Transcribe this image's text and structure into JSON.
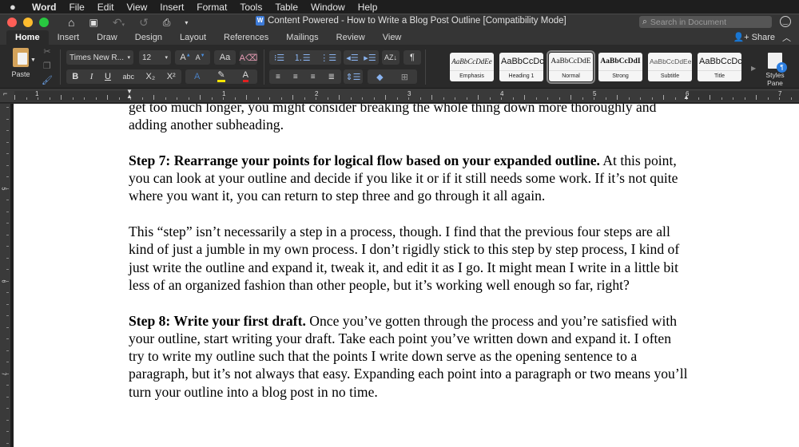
{
  "menubar": {
    "apple_icon": "apple-logo-icon",
    "items": [
      "Word",
      "File",
      "Edit",
      "View",
      "Insert",
      "Format",
      "Tools",
      "Table",
      "Window",
      "Help"
    ]
  },
  "window": {
    "title": "Content Powered - How to Write a Blog Post Outline [Compatibility Mode]",
    "traffic_lights": {
      "close": "#ff5f57",
      "minimize": "#febc2e",
      "zoom": "#28c840"
    },
    "quick_access": [
      "home-icon",
      "save-icon",
      "undo-icon",
      "redo-icon",
      "print-icon",
      "customize-icon"
    ],
    "search_placeholder": "Search in Document"
  },
  "tabs": {
    "items": [
      "Home",
      "Insert",
      "Draw",
      "Design",
      "Layout",
      "References",
      "Mailings",
      "Review",
      "View"
    ],
    "active": "Home",
    "share_label": "Share"
  },
  "ribbon": {
    "paste_label": "Paste",
    "font_name": "Times New R...",
    "font_size": "12",
    "format_buttons": [
      "B",
      "I",
      "U",
      "abc",
      "X₂",
      "X²"
    ],
    "styles": [
      {
        "preview": "AaBbCcDdEe",
        "label": "Emphasis"
      },
      {
        "preview": "AaBbCcDc",
        "label": "Heading 1"
      },
      {
        "preview": "AaBbCcDdE",
        "label": "Normal",
        "selected": true
      },
      {
        "preview": "AaBbCcDdI",
        "label": "Strong"
      },
      {
        "preview": "AaBbCcDdEe",
        "label": "Subtitle"
      },
      {
        "preview": "AaBbCcDc",
        "label": "Title"
      }
    ],
    "styles_pane_label_1": "Styles",
    "styles_pane_label_2": "Pane",
    "highlight_color": "#f5e400",
    "font_color": "#e02020",
    "accent": "#2b7de0"
  },
  "ruler": {
    "labels": [
      "1",
      "1",
      "2",
      "3",
      "4",
      "5",
      "6",
      "7"
    ],
    "vertical_labels": [
      "5",
      "6",
      "7"
    ]
  },
  "document": {
    "p0": "get too much longer, you might consider breaking the whole thing down more thoroughly and adding another subheading.",
    "p1_bold": "Step 7: Rearrange your points for logical flow based on your expanded outline.",
    "p1_rest": "  At this point, you can look at your outline and decide if you like it or if it still needs some work.  If it’s not quite where you want it, you can return to step three and go through it all again.",
    "p2": "This “step” isn’t necessarily a step in a process, though.  I find that the previous four steps are all kind of just a jumble in my own process.  I don’t rigidly stick to this step by step process, I kind of just write the outline and expand it, tweak it, and edit it as I go.  It might mean I write in a little bit less of an organized fashion than other people, but it’s working well enough so far, right?",
    "p3_bold": "Step 8: Write your first draft.",
    "p3_rest": "  Once you’ve gotten through the process and you’re satisfied with your outline, start writing your draft.  Take each point you’ve written down and expand it.  I often try to write my outline such that the points I write down serve as the opening sentence to a paragraph, but it’s not always that easy.  Expanding each point into a paragraph or two means you’ll turn your outline into a blog post in no time."
  }
}
